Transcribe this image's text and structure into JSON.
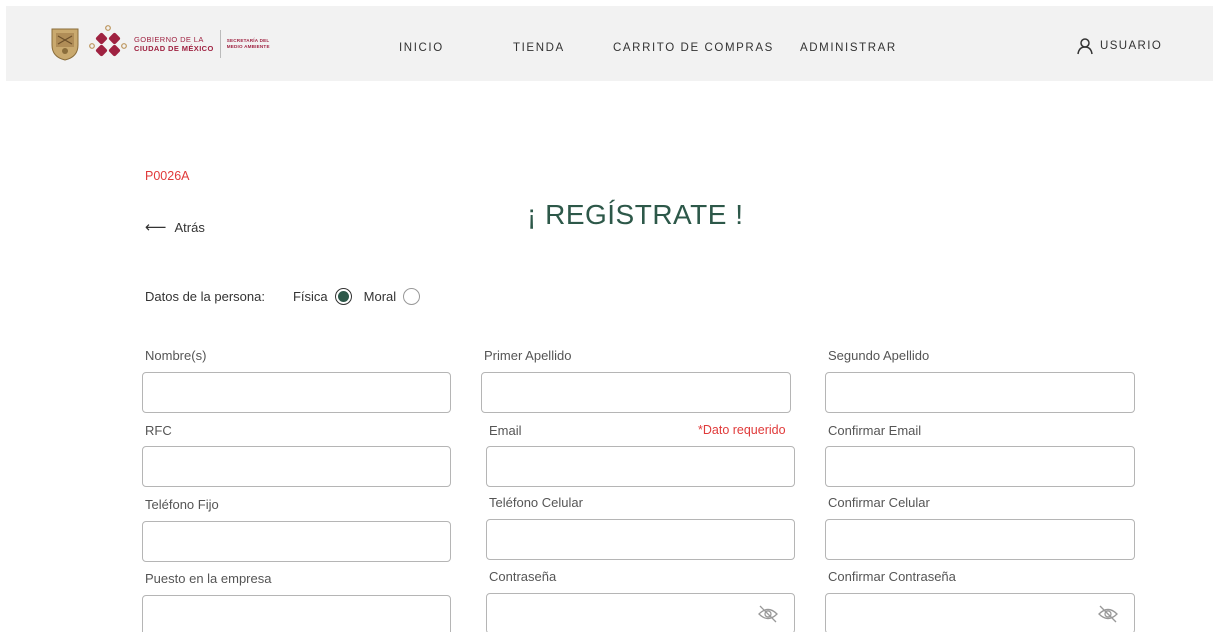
{
  "header": {
    "brand_line1": "GOBIERNO DE LA",
    "brand_line2": "CIUDAD DE MÉXICO",
    "secretaria_line1": "SECRETARÍA DEL",
    "secretaria_line2": "MEDIO AMBIENTE",
    "nav": [
      {
        "label": "INICIO"
      },
      {
        "label": "TIENDA"
      },
      {
        "label": "CARRITO DE COMPRAS"
      },
      {
        "label": "ADMINISTRAR"
      }
    ],
    "user_label": "USUARIO"
  },
  "page": {
    "code": "P0026A",
    "back_label": "Atrás",
    "title": "¡ REGÍSTRATE !",
    "persona_label": "Datos de la persona:",
    "persona_options": [
      {
        "label": "Física",
        "selected": true
      },
      {
        "label": "Moral",
        "selected": false
      }
    ]
  },
  "form": {
    "nombre": {
      "label": "Nombre(s)",
      "value": ""
    },
    "primer_apellido": {
      "label": "Primer Apellido",
      "value": ""
    },
    "segundo_apellido": {
      "label": "Segundo Apellido",
      "value": ""
    },
    "rfc": {
      "label": "RFC",
      "value": ""
    },
    "email": {
      "label": "Email",
      "value": "",
      "error": "*Dato requerido"
    },
    "confirmar_email": {
      "label": "Confirmar Email",
      "value": ""
    },
    "telefono_fijo": {
      "label": "Teléfono Fijo",
      "value": ""
    },
    "telefono_celular": {
      "label": "Teléfono Celular",
      "value": ""
    },
    "confirmar_celular": {
      "label": "Confirmar Celular",
      "value": ""
    },
    "puesto": {
      "label": "Puesto en la empresa",
      "value": ""
    },
    "contrasena": {
      "label": "Contraseña",
      "value": "",
      "icon": "eye-off-icon"
    },
    "confirmar_contrasena": {
      "label": "Confirmar Contraseña",
      "value": "",
      "icon": "eye-off-icon"
    }
  },
  "colors": {
    "brand": "#9f2241",
    "accent": "#2d5849",
    "error": "#e03a3a",
    "header_bg": "#f2f2f2"
  }
}
